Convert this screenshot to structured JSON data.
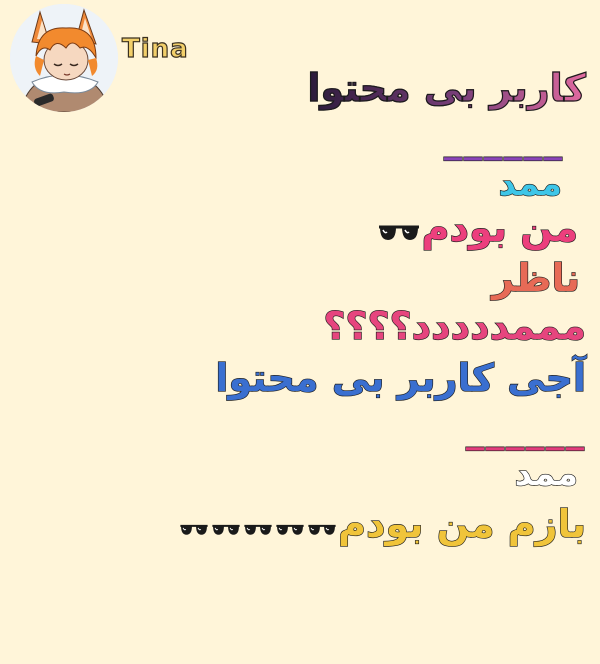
{
  "header": {
    "username": "Tina"
  },
  "content": {
    "title": "کاربر بی محتوا",
    "dash_1": "______",
    "speaker_1": "ممد",
    "message_1": "من بودم",
    "message_1_glasses": 1,
    "message_2": "ناظر",
    "message_3": "مممددددد؟؟؟؟",
    "message_4": "آجی کاربر بی محتوا",
    "dash_2": "______",
    "speaker_2": "ممد",
    "message_5": "بازم من بودم",
    "message_5_glasses": 5
  },
  "icons": {
    "glasses": "sunglasses-icon",
    "avatar": "orange-hair-fox-ear-character-avatar"
  }
}
